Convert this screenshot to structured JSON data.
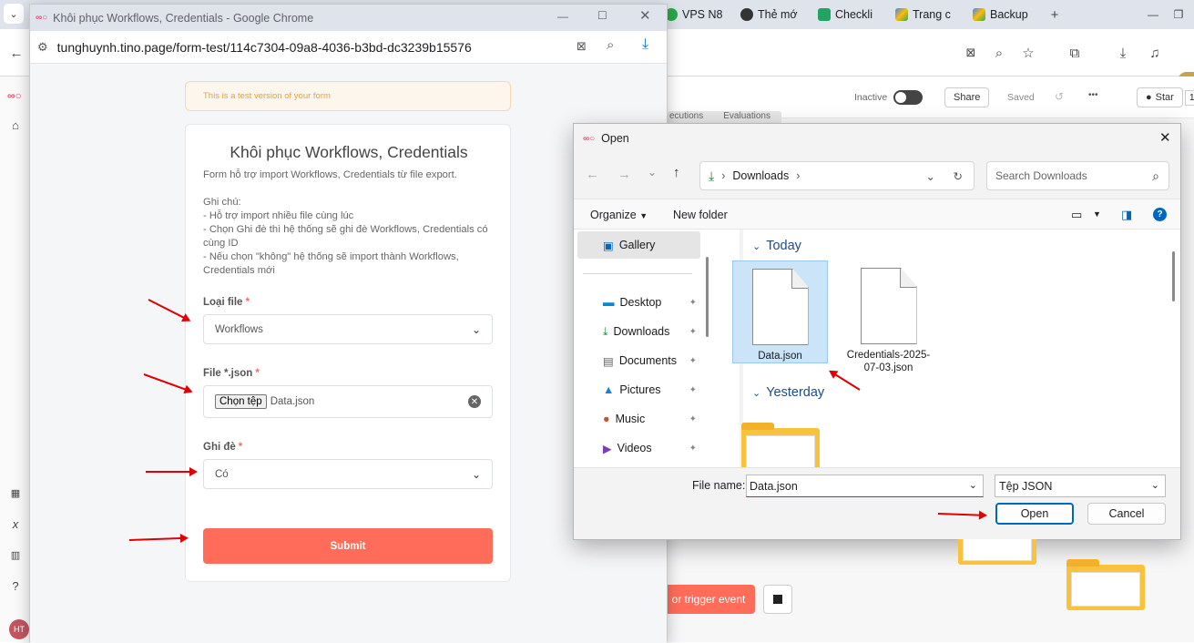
{
  "browser_bg": {
    "tabs": [
      {
        "label": "VPS N8",
        "color": "#2aa84a"
      },
      {
        "label": "Thẻ mớ",
        "color": "#333333"
      },
      {
        "label": "Checkli",
        "color": "#1fa463"
      },
      {
        "label": "Trang c",
        "color": "#4285f4"
      },
      {
        "label": "Backup",
        "color": "#4285f4"
      }
    ],
    "new_tab": "+"
  },
  "n8n": {
    "inactive_label": "Inactive",
    "share_label": "Share",
    "saved_label": "Saved",
    "more": "•••",
    "star_label": "Star",
    "star_count": "1",
    "tabs": [
      "ecutions",
      "Evaluations"
    ],
    "trigger_label": "or trigger event",
    "avatar": "HT"
  },
  "popup": {
    "title": "Khôi phục Workflows, Credentials - Google Chrome",
    "url": "tunghuynh.tino.page/form-test/114c7304-09a8-4036-b3bd-dc3239b15576",
    "banner": "This is a test version of your form",
    "form": {
      "title": "Khôi phục Workflows, Credentials",
      "description": "Form hỗ trợ import Workflows, Credentials từ file export.\n\nGhi chú:\n- Hỗ trợ import nhiều file cùng lúc\n- Chọn Ghi đè thì hệ thống sẽ ghi đè Workflows, Credentials có cùng ID\n- Nếu chọn \"không\" hệ thống sẽ import thành Workflows, Credentials mới",
      "file_type_label": "Loại file",
      "file_type_value": "Workflows",
      "file_label": "File *.json",
      "choose_button": "Chọn tệp",
      "chosen_file": "Data.json",
      "overwrite_label": "Ghi đè",
      "overwrite_value": "Có",
      "required_mark": "*",
      "submit": "Submit"
    }
  },
  "dialog": {
    "title": "Open",
    "path_root": "Downloads",
    "search_placeholder": "Search Downloads",
    "organize": "Organize",
    "new_folder": "New folder",
    "nav": {
      "gallery": "Gallery",
      "quick": [
        "Desktop",
        "Downloads",
        "Documents",
        "Pictures",
        "Music",
        "Videos"
      ]
    },
    "groups": {
      "today": "Today",
      "yesterday": "Yesterday"
    },
    "files_today": [
      "Data.json",
      "Credentials-2025-07-03.json"
    ],
    "file_name_label": "File name:",
    "file_name_value": "Data.json",
    "file_type": "Tệp JSON",
    "open_button": "Open",
    "cancel_button": "Cancel"
  },
  "colors": {
    "submit": "#ff6d5a",
    "banner_text": "#e6a23c",
    "arrow": "#e00000",
    "dialog_accent": "#0067c0"
  }
}
